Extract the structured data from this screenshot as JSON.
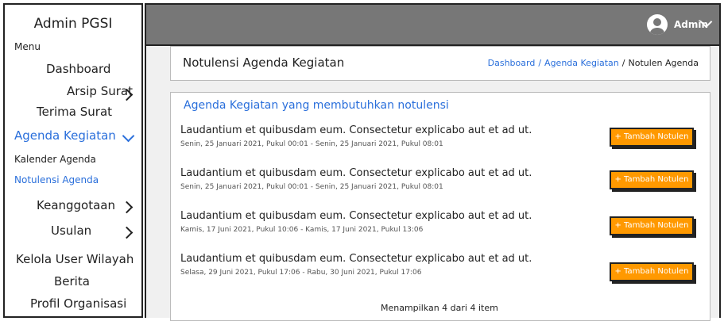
{
  "sidebar": {
    "title": "Admin PGSI",
    "menu_label": "Menu",
    "items": [
      {
        "label": "Dashboard"
      },
      {
        "label": "Arsip Surat"
      },
      {
        "label": "Terima Surat"
      },
      {
        "label": "Agenda Kegiatan"
      },
      {
        "label": "Kalender Agenda"
      },
      {
        "label": "Notulensi Agenda"
      },
      {
        "label": "Keanggotaan"
      },
      {
        "label": "Usulan"
      },
      {
        "label": "Kelola User Wilayah"
      },
      {
        "label": "Berita"
      },
      {
        "label": "Profil Organisasi"
      }
    ]
  },
  "topbar": {
    "user_label": "Admin"
  },
  "page": {
    "title": "Notulensi Agenda Kegiatan",
    "breadcrumb": [
      "Dashboard",
      "Agenda Kegiatan",
      "Notulen Agenda"
    ]
  },
  "main": {
    "heading": "Agenda Kegiatan yang membutuhkan notulensi",
    "button_label": "+ Tambah Notulen",
    "items": [
      {
        "title": "Laudantium et quibusdam eum. Consectetur explicabo aut et ad ut.",
        "time": "Senin, 25 Januari 2021, Pukul 00:01 - Senin, 25 Januari 2021, Pukul 08:01"
      },
      {
        "title": "Laudantium et quibusdam eum. Consectetur explicabo aut et ad ut.",
        "time": "Senin, 25 Januari 2021, Pukul 00:01 - Senin, 25 Januari 2021, Pukul 08:01"
      },
      {
        "title": "Laudantium et quibusdam eum. Consectetur explicabo aut et ad ut.",
        "time": "Kamis, 17 Juni 2021, Pukul 10:06 - Kamis, 17 Juni 2021, Pukul 13:06"
      },
      {
        "title": "Laudantium et quibusdam eum. Consectetur explicabo aut et ad ut.",
        "time": "Selasa, 29 Juni 2021, Pukul 17:06 - Rabu, 30 Juni 2021, Pukul 17:06"
      }
    ],
    "footer": "Menampilkan 4 dari 4 item"
  },
  "colors": {
    "accent": "#2a6fdb",
    "button": "#ff9900",
    "topbar": "#777777",
    "content_bg": "#f0f0f0"
  }
}
